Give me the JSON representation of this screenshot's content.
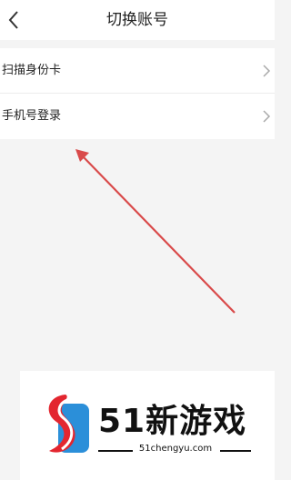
{
  "header": {
    "title": "切换账号",
    "back_icon": "back-chevron-icon"
  },
  "menu": {
    "items": [
      {
        "label": "扫描身份卡",
        "icon": "chevron-right-icon"
      },
      {
        "label": "手机号登录",
        "icon": "chevron-right-icon"
      }
    ]
  },
  "annotation": {
    "arrow_color": "#d94a4a",
    "arrow_icon": "red-arrow-icon"
  },
  "watermark": {
    "brand": "51新游戏",
    "url": "51chengyu.com",
    "colors": {
      "red": "#e3262f",
      "blue": "#2b8fd9",
      "text": "#111111"
    }
  }
}
